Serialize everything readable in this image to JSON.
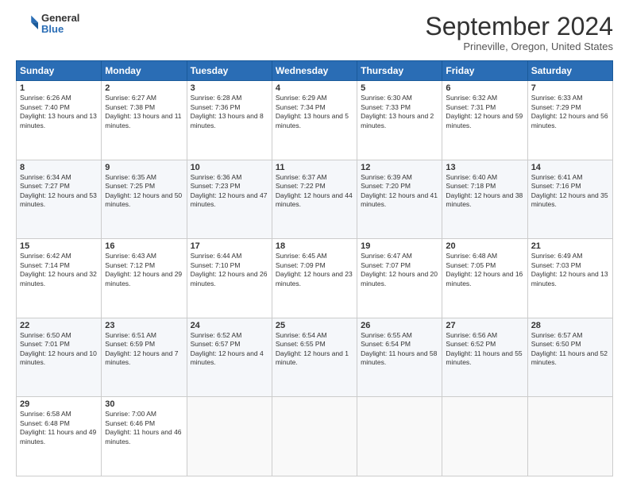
{
  "header": {
    "logo_general": "General",
    "logo_blue": "Blue",
    "month_title": "September 2024",
    "location": "Prineville, Oregon, United States"
  },
  "days_of_week": [
    "Sunday",
    "Monday",
    "Tuesday",
    "Wednesday",
    "Thursday",
    "Friday",
    "Saturday"
  ],
  "weeks": [
    [
      {
        "day": "1",
        "sunrise": "Sunrise: 6:26 AM",
        "sunset": "Sunset: 7:40 PM",
        "daylight": "Daylight: 13 hours and 13 minutes."
      },
      {
        "day": "2",
        "sunrise": "Sunrise: 6:27 AM",
        "sunset": "Sunset: 7:38 PM",
        "daylight": "Daylight: 13 hours and 11 minutes."
      },
      {
        "day": "3",
        "sunrise": "Sunrise: 6:28 AM",
        "sunset": "Sunset: 7:36 PM",
        "daylight": "Daylight: 13 hours and 8 minutes."
      },
      {
        "day": "4",
        "sunrise": "Sunrise: 6:29 AM",
        "sunset": "Sunset: 7:34 PM",
        "daylight": "Daylight: 13 hours and 5 minutes."
      },
      {
        "day": "5",
        "sunrise": "Sunrise: 6:30 AM",
        "sunset": "Sunset: 7:33 PM",
        "daylight": "Daylight: 13 hours and 2 minutes."
      },
      {
        "day": "6",
        "sunrise": "Sunrise: 6:32 AM",
        "sunset": "Sunset: 7:31 PM",
        "daylight": "Daylight: 12 hours and 59 minutes."
      },
      {
        "day": "7",
        "sunrise": "Sunrise: 6:33 AM",
        "sunset": "Sunset: 7:29 PM",
        "daylight": "Daylight: 12 hours and 56 minutes."
      }
    ],
    [
      {
        "day": "8",
        "sunrise": "Sunrise: 6:34 AM",
        "sunset": "Sunset: 7:27 PM",
        "daylight": "Daylight: 12 hours and 53 minutes."
      },
      {
        "day": "9",
        "sunrise": "Sunrise: 6:35 AM",
        "sunset": "Sunset: 7:25 PM",
        "daylight": "Daylight: 12 hours and 50 minutes."
      },
      {
        "day": "10",
        "sunrise": "Sunrise: 6:36 AM",
        "sunset": "Sunset: 7:23 PM",
        "daylight": "Daylight: 12 hours and 47 minutes."
      },
      {
        "day": "11",
        "sunrise": "Sunrise: 6:37 AM",
        "sunset": "Sunset: 7:22 PM",
        "daylight": "Daylight: 12 hours and 44 minutes."
      },
      {
        "day": "12",
        "sunrise": "Sunrise: 6:39 AM",
        "sunset": "Sunset: 7:20 PM",
        "daylight": "Daylight: 12 hours and 41 minutes."
      },
      {
        "day": "13",
        "sunrise": "Sunrise: 6:40 AM",
        "sunset": "Sunset: 7:18 PM",
        "daylight": "Daylight: 12 hours and 38 minutes."
      },
      {
        "day": "14",
        "sunrise": "Sunrise: 6:41 AM",
        "sunset": "Sunset: 7:16 PM",
        "daylight": "Daylight: 12 hours and 35 minutes."
      }
    ],
    [
      {
        "day": "15",
        "sunrise": "Sunrise: 6:42 AM",
        "sunset": "Sunset: 7:14 PM",
        "daylight": "Daylight: 12 hours and 32 minutes."
      },
      {
        "day": "16",
        "sunrise": "Sunrise: 6:43 AM",
        "sunset": "Sunset: 7:12 PM",
        "daylight": "Daylight: 12 hours and 29 minutes."
      },
      {
        "day": "17",
        "sunrise": "Sunrise: 6:44 AM",
        "sunset": "Sunset: 7:10 PM",
        "daylight": "Daylight: 12 hours and 26 minutes."
      },
      {
        "day": "18",
        "sunrise": "Sunrise: 6:45 AM",
        "sunset": "Sunset: 7:09 PM",
        "daylight": "Daylight: 12 hours and 23 minutes."
      },
      {
        "day": "19",
        "sunrise": "Sunrise: 6:47 AM",
        "sunset": "Sunset: 7:07 PM",
        "daylight": "Daylight: 12 hours and 20 minutes."
      },
      {
        "day": "20",
        "sunrise": "Sunrise: 6:48 AM",
        "sunset": "Sunset: 7:05 PM",
        "daylight": "Daylight: 12 hours and 16 minutes."
      },
      {
        "day": "21",
        "sunrise": "Sunrise: 6:49 AM",
        "sunset": "Sunset: 7:03 PM",
        "daylight": "Daylight: 12 hours and 13 minutes."
      }
    ],
    [
      {
        "day": "22",
        "sunrise": "Sunrise: 6:50 AM",
        "sunset": "Sunset: 7:01 PM",
        "daylight": "Daylight: 12 hours and 10 minutes."
      },
      {
        "day": "23",
        "sunrise": "Sunrise: 6:51 AM",
        "sunset": "Sunset: 6:59 PM",
        "daylight": "Daylight: 12 hours and 7 minutes."
      },
      {
        "day": "24",
        "sunrise": "Sunrise: 6:52 AM",
        "sunset": "Sunset: 6:57 PM",
        "daylight": "Daylight: 12 hours and 4 minutes."
      },
      {
        "day": "25",
        "sunrise": "Sunrise: 6:54 AM",
        "sunset": "Sunset: 6:55 PM",
        "daylight": "Daylight: 12 hours and 1 minute."
      },
      {
        "day": "26",
        "sunrise": "Sunrise: 6:55 AM",
        "sunset": "Sunset: 6:54 PM",
        "daylight": "Daylight: 11 hours and 58 minutes."
      },
      {
        "day": "27",
        "sunrise": "Sunrise: 6:56 AM",
        "sunset": "Sunset: 6:52 PM",
        "daylight": "Daylight: 11 hours and 55 minutes."
      },
      {
        "day": "28",
        "sunrise": "Sunrise: 6:57 AM",
        "sunset": "Sunset: 6:50 PM",
        "daylight": "Daylight: 11 hours and 52 minutes."
      }
    ],
    [
      {
        "day": "29",
        "sunrise": "Sunrise: 6:58 AM",
        "sunset": "Sunset: 6:48 PM",
        "daylight": "Daylight: 11 hours and 49 minutes."
      },
      {
        "day": "30",
        "sunrise": "Sunrise: 7:00 AM",
        "sunset": "Sunset: 6:46 PM",
        "daylight": "Daylight: 11 hours and 46 minutes."
      },
      null,
      null,
      null,
      null,
      null
    ]
  ]
}
